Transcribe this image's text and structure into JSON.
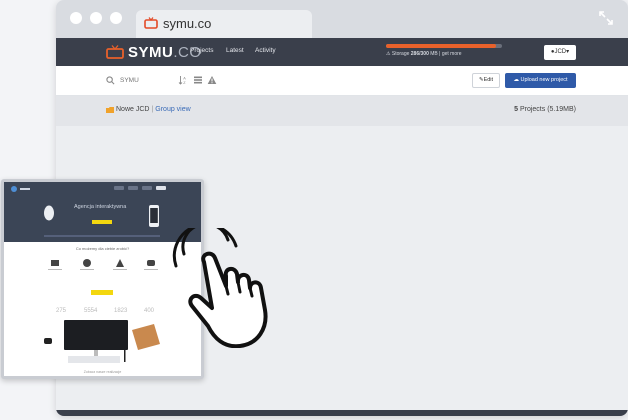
{
  "browser": {
    "tab_title": "symu.co"
  },
  "app": {
    "logo": "SYMU",
    "logo_suffix": ".CO",
    "nav": [
      "Projects",
      "Latest",
      "Activity"
    ],
    "storage": {
      "fraction": 0.95,
      "prefix": "Storage",
      "amount": "286/300",
      "unit": "MB",
      "link": "get more"
    },
    "user_label": "JCD"
  },
  "toolbar": {
    "search_placeholder": "SYMU",
    "edit_label": "Edit",
    "upload_label": "Upload new project"
  },
  "breadcrumb": {
    "folder": "Nowe JCD",
    "view": "Group view",
    "count": "5",
    "count_label": "Projects (5.19MB)"
  },
  "thumbnail": {
    "hero_title": "Agencja interaktywna",
    "section_title": "Co możemy dla ciebie zrobić?",
    "stats": [
      "275",
      "5554",
      "1823",
      "400"
    ],
    "footer": "Zobacz nasze realizacje"
  },
  "colors": {
    "accent": "#e8612b",
    "header": "#3a3f4b",
    "primary_button": "#2f5aa8"
  }
}
